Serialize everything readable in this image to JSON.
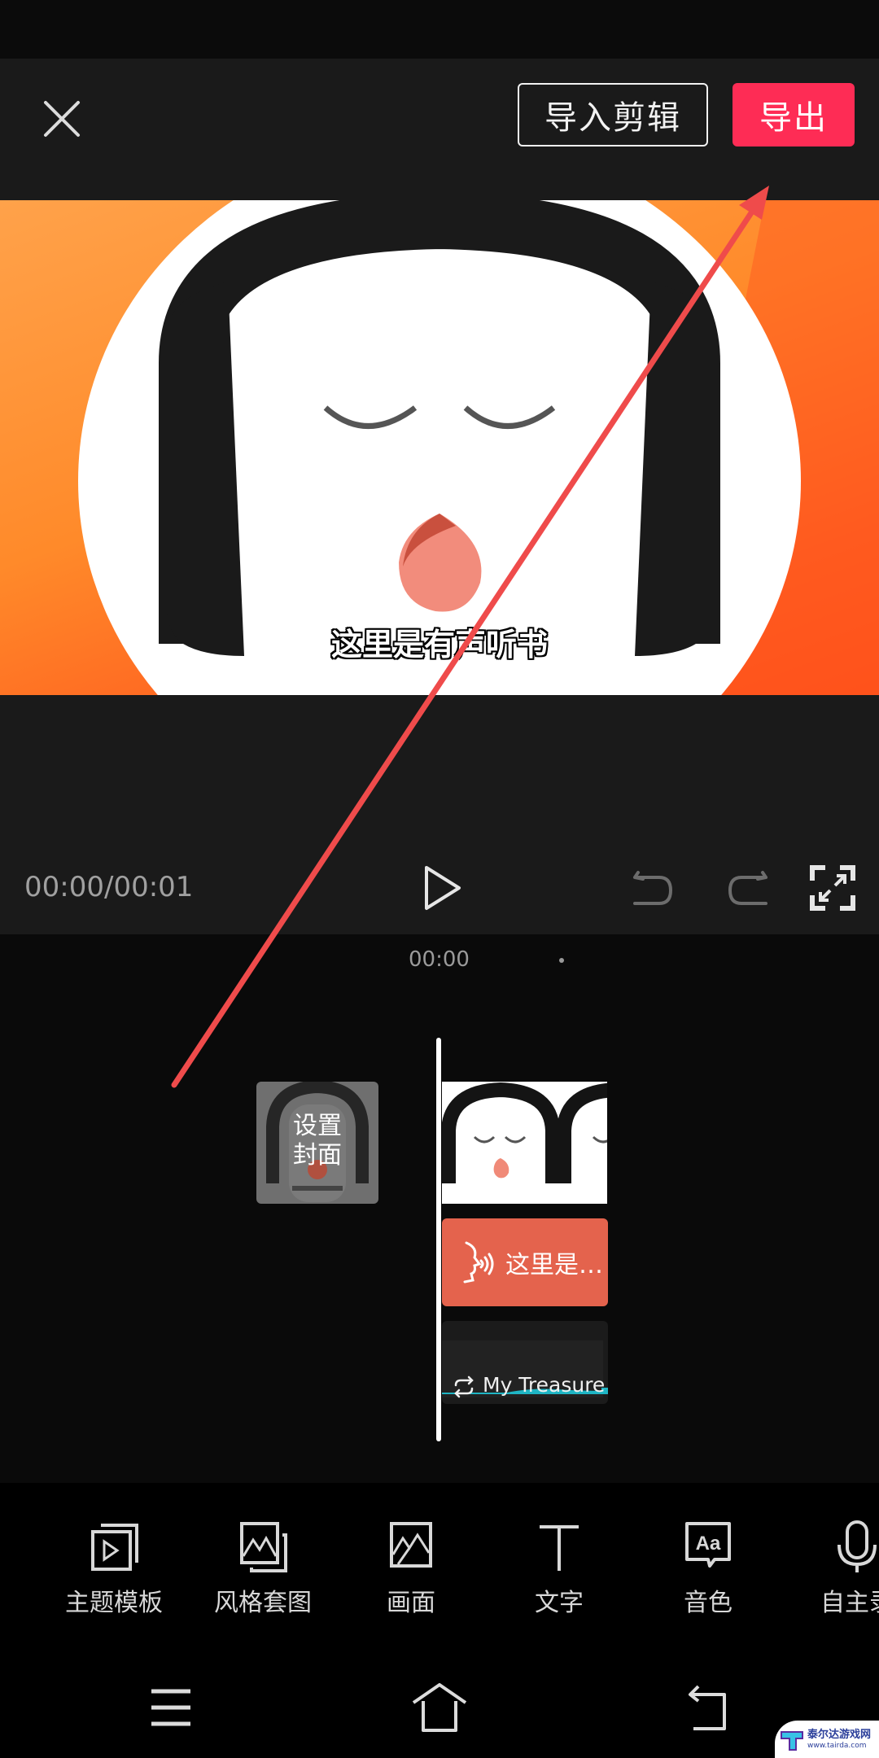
{
  "header": {
    "close_icon": "close-icon",
    "import_label": "导入剪辑",
    "export_label": "导出",
    "export_color": "#fe2c55"
  },
  "preview": {
    "subtitle": "这里是有声听书"
  },
  "player": {
    "timecode": "00:00/00:01",
    "play_icon": "play-icon",
    "undo_icon": "undo-icon",
    "redo_icon": "redo-icon",
    "fullscreen_icon": "fullscreen-icon"
  },
  "timeline": {
    "ruler_time": "00:00",
    "cover_label_line1": "设置",
    "cover_label_line2": "封面",
    "tts_clip_label": "这里是…",
    "tts_clip_color": "#e4634d",
    "music_clip_label": "My Treasure",
    "music_wave_color": "#1fb5c4"
  },
  "toolbar": {
    "items": [
      {
        "label": "主题模板",
        "icon": "theme-template-icon"
      },
      {
        "label": "风格套图",
        "icon": "style-set-icon"
      },
      {
        "label": "画面",
        "icon": "image-icon"
      },
      {
        "label": "文字",
        "icon": "text-icon"
      },
      {
        "label": "音色",
        "icon": "voice-tone-icon"
      },
      {
        "label": "自主录",
        "icon": "microphone-icon"
      }
    ]
  },
  "navbar": {
    "menu_icon": "menu-icon",
    "home_icon": "home-icon",
    "back_icon": "back-icon"
  },
  "watermark": {
    "title": "泰尔达游戏网",
    "url": "www.tairda.com"
  },
  "annotation": {
    "arrow_color": "#ef4b4b"
  }
}
